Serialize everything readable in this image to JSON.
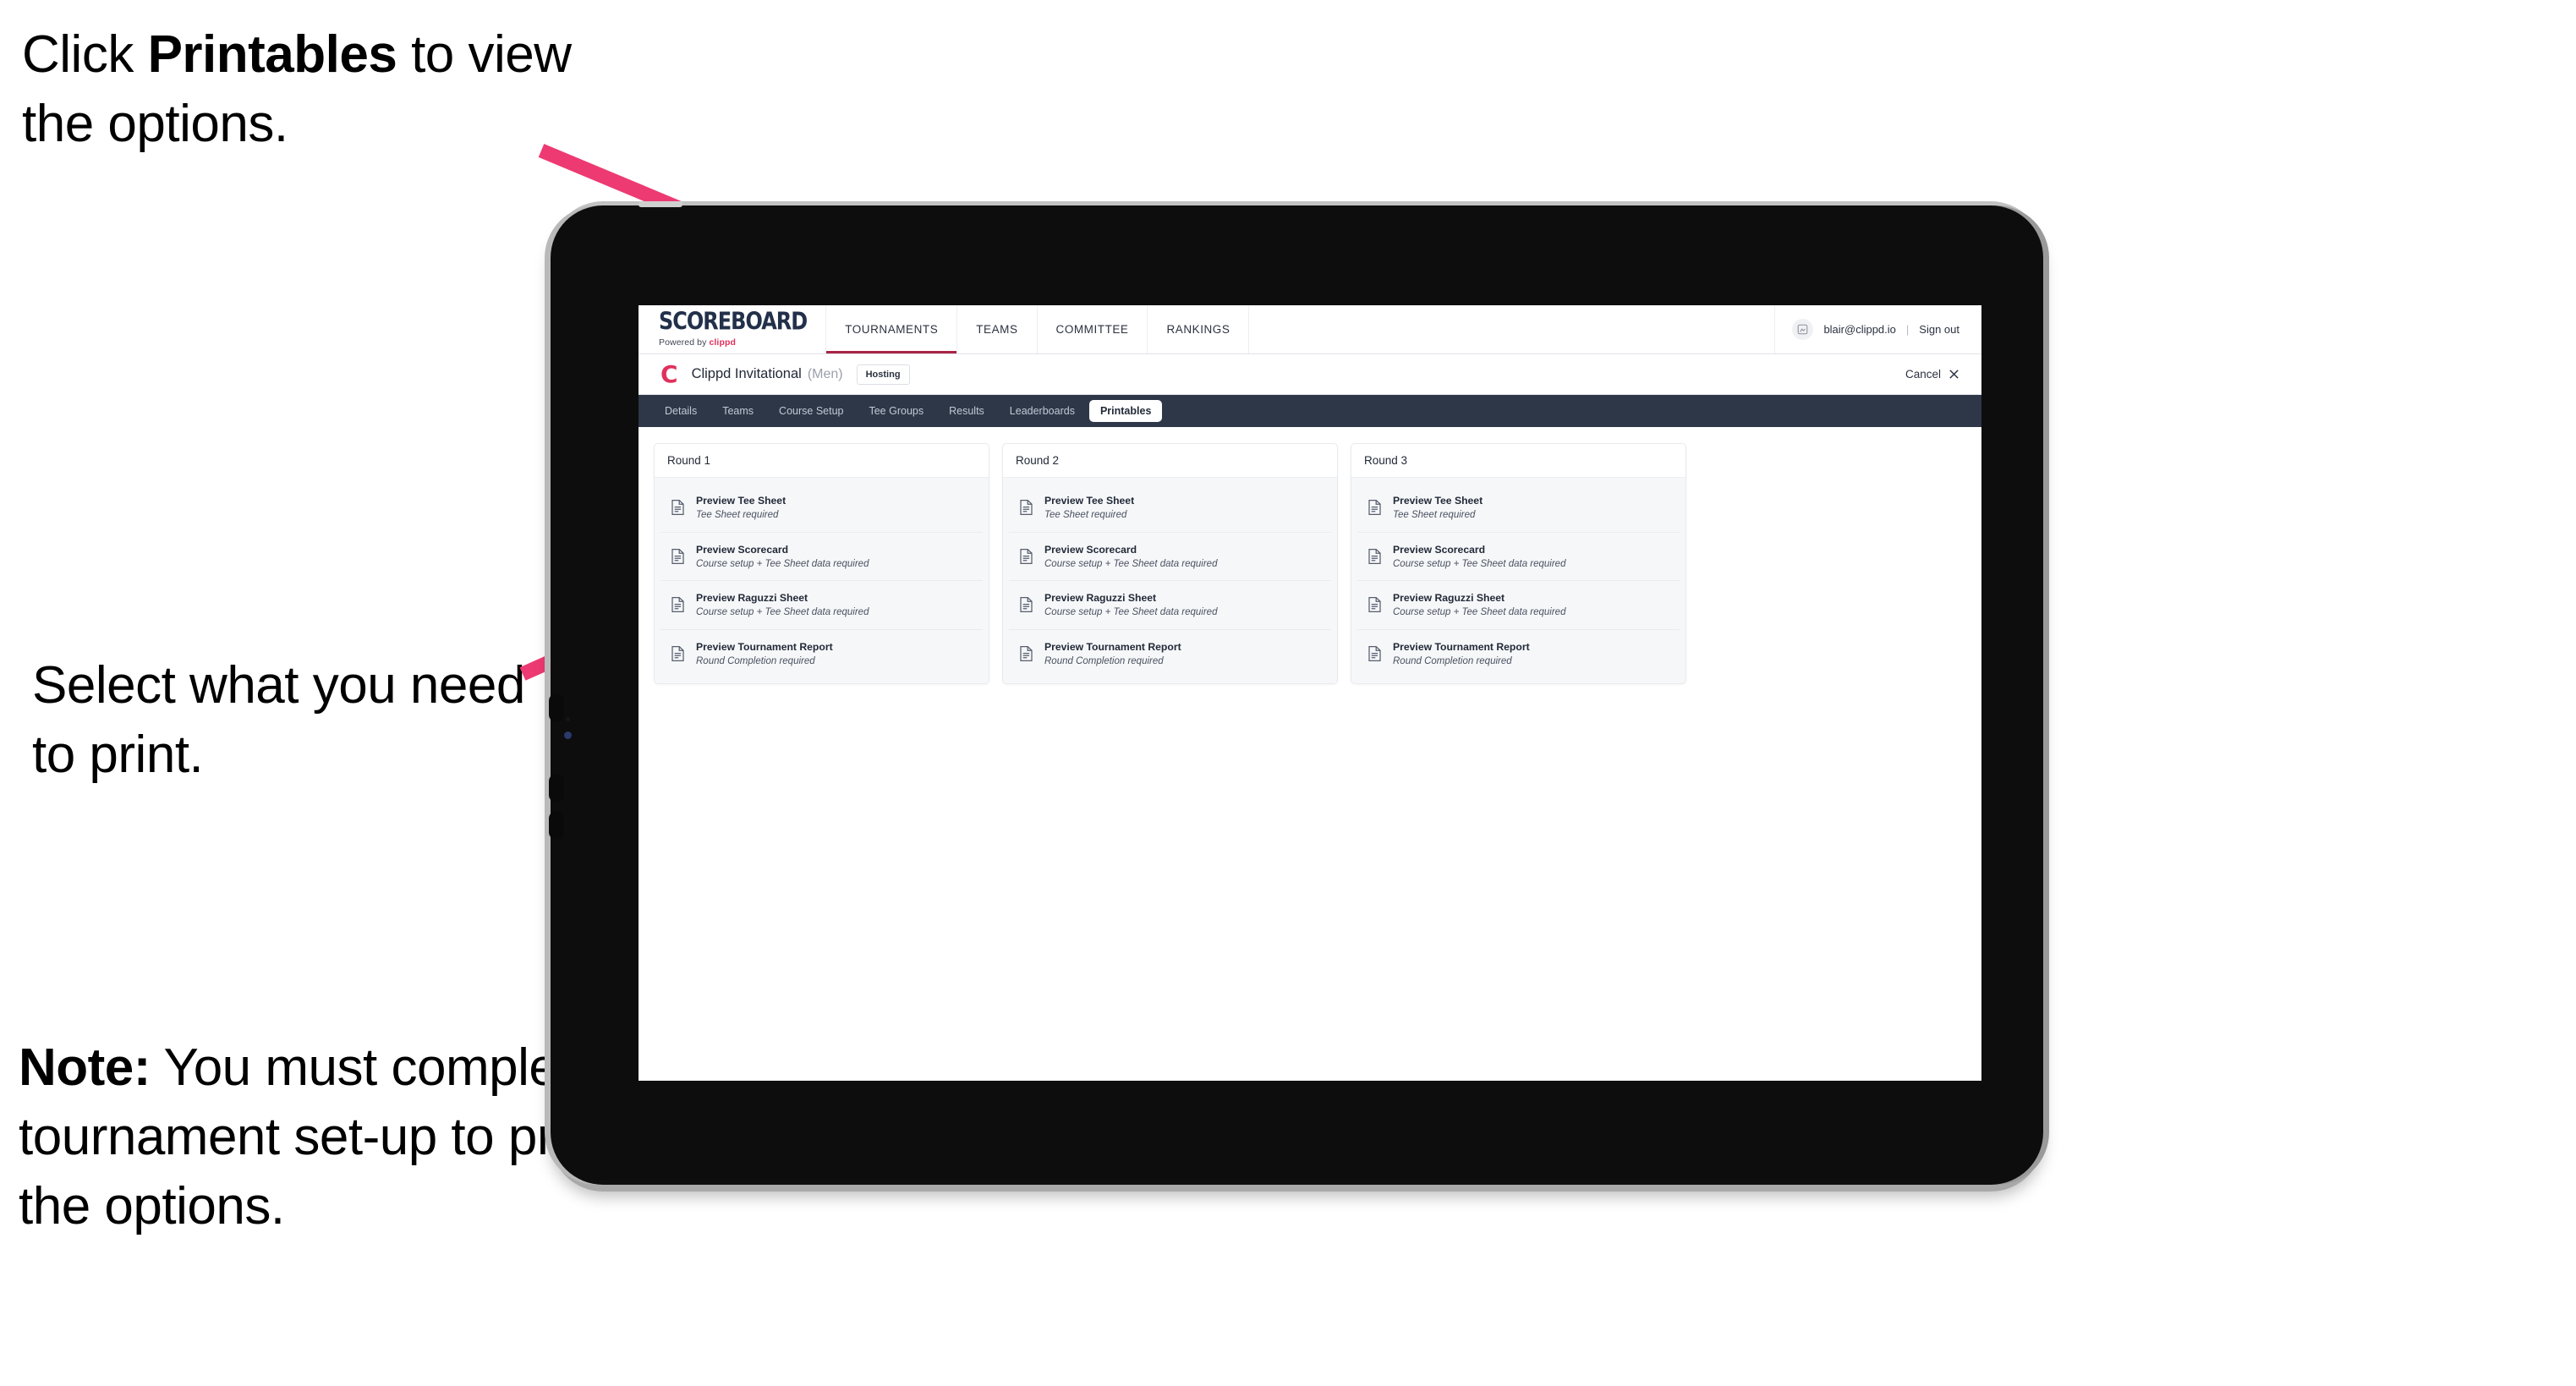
{
  "annotations": {
    "top": {
      "prefix": "Click ",
      "bold": "Printables",
      "suffix": " to view the options."
    },
    "middle": {
      "text": "Select what you need to print."
    },
    "note": {
      "bold": "Note:",
      "text": " You must complete the tournament set-up to print all the options."
    }
  },
  "app": {
    "brand": {
      "title": "SCOREBOARD",
      "powered_prefix": "Powered by ",
      "powered_brand": "clippd"
    },
    "nav": [
      {
        "label": "TOURNAMENTS",
        "active": true
      },
      {
        "label": "TEAMS",
        "active": false
      },
      {
        "label": "COMMITTEE",
        "active": false
      },
      {
        "label": "RANKINGS",
        "active": false
      }
    ],
    "user": {
      "avatar_icon": "user-avatar-icon",
      "email": "blair@clippd.io",
      "separator": "|",
      "signout_label": "Sign out"
    },
    "title_row": {
      "logo_letter": "C",
      "tournament_name": "Clippd Invitational",
      "gender": "(Men)",
      "hosting_badge": "Hosting",
      "cancel_label": "Cancel",
      "cancel_icon": "close-x-icon"
    },
    "tabs": [
      {
        "label": "Details",
        "active": false
      },
      {
        "label": "Teams",
        "active": false
      },
      {
        "label": "Course Setup",
        "active": false
      },
      {
        "label": "Tee Groups",
        "active": false
      },
      {
        "label": "Results",
        "active": false
      },
      {
        "label": "Leaderboards",
        "active": false
      },
      {
        "label": "Printables",
        "active": true
      }
    ],
    "rounds": [
      {
        "title": "Round 1",
        "items": [
          {
            "icon": "document-icon",
            "title": "Preview Tee Sheet",
            "subtitle": "Tee Sheet required"
          },
          {
            "icon": "document-icon",
            "title": "Preview Scorecard",
            "subtitle": "Course setup + Tee Sheet data required"
          },
          {
            "icon": "document-icon",
            "title": "Preview Raguzzi Sheet",
            "subtitle": "Course setup + Tee Sheet data required"
          },
          {
            "icon": "document-icon",
            "title": "Preview Tournament Report",
            "subtitle": "Round Completion required"
          }
        ]
      },
      {
        "title": "Round 2",
        "items": [
          {
            "icon": "document-icon",
            "title": "Preview Tee Sheet",
            "subtitle": "Tee Sheet required"
          },
          {
            "icon": "document-icon",
            "title": "Preview Scorecard",
            "subtitle": "Course setup + Tee Sheet data required"
          },
          {
            "icon": "document-icon",
            "title": "Preview Raguzzi Sheet",
            "subtitle": "Course setup + Tee Sheet data required"
          },
          {
            "icon": "document-icon",
            "title": "Preview Tournament Report",
            "subtitle": "Round Completion required"
          }
        ]
      },
      {
        "title": "Round 3",
        "items": [
          {
            "icon": "document-icon",
            "title": "Preview Tee Sheet",
            "subtitle": "Tee Sheet required"
          },
          {
            "icon": "document-icon",
            "title": "Preview Scorecard",
            "subtitle": "Course setup + Tee Sheet data required"
          },
          {
            "icon": "document-icon",
            "title": "Preview Raguzzi Sheet",
            "subtitle": "Course setup + Tee Sheet data required"
          },
          {
            "icon": "document-icon",
            "title": "Preview Tournament Report",
            "subtitle": "Round Completion required"
          }
        ]
      }
    ]
  },
  "colors": {
    "arrow": "#ed3a72",
    "accent_pink": "#e0315b",
    "nav_active_underline": "#a92545",
    "tabstrip_bg": "#2d3748",
    "bezel": "#0d0d0d"
  }
}
